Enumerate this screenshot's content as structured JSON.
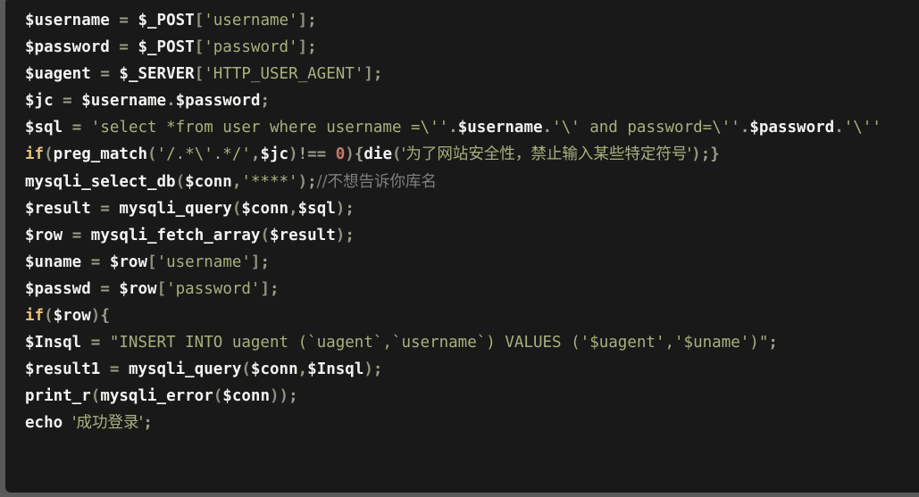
{
  "editor": {
    "language": "php",
    "background_color": "#191919",
    "frame_color": "#5a5a5a",
    "font": "monospace",
    "line_count": 16
  },
  "colors": {
    "variable": "#f2f2f0",
    "string": "#a9b07d",
    "keyword": "#e8c07a",
    "number": "#cc7a6b",
    "comment": "#7e7e7e",
    "operator": "#9aa08a"
  },
  "code": {
    "lines": [
      {
        "n": 1,
        "text": "$username = $_POST['username'];",
        "tokens": [
          {
            "t": "$username",
            "c": "t-var"
          },
          {
            "t": " ",
            "c": "t-plain"
          },
          {
            "t": "=",
            "c": "t-op"
          },
          {
            "t": " ",
            "c": "t-plain"
          },
          {
            "t": "$_POST",
            "c": "t-var"
          },
          {
            "t": "[",
            "c": "t-brk"
          },
          {
            "t": "'username'",
            "c": "t-str"
          },
          {
            "t": "]",
            "c": "t-brk"
          },
          {
            "t": ";",
            "c": "t-punc"
          }
        ]
      },
      {
        "n": 2,
        "text": "$password = $_POST['password'];",
        "tokens": [
          {
            "t": "$password",
            "c": "t-var"
          },
          {
            "t": " ",
            "c": "t-plain"
          },
          {
            "t": "=",
            "c": "t-op"
          },
          {
            "t": " ",
            "c": "t-plain"
          },
          {
            "t": "$_POST",
            "c": "t-var"
          },
          {
            "t": "[",
            "c": "t-brk"
          },
          {
            "t": "'password'",
            "c": "t-str"
          },
          {
            "t": "]",
            "c": "t-brk"
          },
          {
            "t": ";",
            "c": "t-punc"
          }
        ]
      },
      {
        "n": 3,
        "text": "$uagent = $_SERVER['HTTP_USER_AGENT'];",
        "tokens": [
          {
            "t": "$uagent",
            "c": "t-var"
          },
          {
            "t": " ",
            "c": "t-plain"
          },
          {
            "t": "=",
            "c": "t-op"
          },
          {
            "t": " ",
            "c": "t-plain"
          },
          {
            "t": "$_SERVER",
            "c": "t-var"
          },
          {
            "t": "[",
            "c": "t-brk"
          },
          {
            "t": "'HTTP_USER_AGENT'",
            "c": "t-str"
          },
          {
            "t": "]",
            "c": "t-brk"
          },
          {
            "t": ";",
            "c": "t-punc"
          }
        ]
      },
      {
        "n": 4,
        "text": "$jc = $username.$password;",
        "tokens": [
          {
            "t": "$jc",
            "c": "t-var"
          },
          {
            "t": " ",
            "c": "t-plain"
          },
          {
            "t": "=",
            "c": "t-op"
          },
          {
            "t": " ",
            "c": "t-plain"
          },
          {
            "t": "$username",
            "c": "t-var"
          },
          {
            "t": ".",
            "c": "t-punc"
          },
          {
            "t": "$password",
            "c": "t-var"
          },
          {
            "t": ";",
            "c": "t-punc"
          }
        ]
      },
      {
        "n": 5,
        "text": "$sql = 'select *from user where username =\\''.$username.'\\' and password=\\''.$password.'\\''",
        "tokens": [
          {
            "t": "$sql",
            "c": "t-var"
          },
          {
            "t": " ",
            "c": "t-plain"
          },
          {
            "t": "=",
            "c": "t-op"
          },
          {
            "t": " ",
            "c": "t-plain"
          },
          {
            "t": "'select *from user where username =\\''",
            "c": "t-str"
          },
          {
            "t": ".",
            "c": "t-punc"
          },
          {
            "t": "$username",
            "c": "t-var"
          },
          {
            "t": ".",
            "c": "t-punc"
          },
          {
            "t": "'\\' and password=\\''",
            "c": "t-str"
          },
          {
            "t": ".",
            "c": "t-punc"
          },
          {
            "t": "$password",
            "c": "t-var"
          },
          {
            "t": ".",
            "c": "t-punc"
          },
          {
            "t": "'\\''",
            "c": "t-str"
          }
        ]
      },
      {
        "n": 6,
        "text": "if(preg_match('/.*\\'.*/',$jc)!== 0){die('为了网站安全性，禁止输入某些特定符号');}",
        "tokens": [
          {
            "t": "if",
            "c": "t-kw"
          },
          {
            "t": "(",
            "c": "t-brk"
          },
          {
            "t": "preg_match",
            "c": "t-fn"
          },
          {
            "t": "(",
            "c": "t-brk"
          },
          {
            "t": "'/.*\\'.*/'",
            "c": "t-str"
          },
          {
            "t": ",",
            "c": "t-punc"
          },
          {
            "t": "$jc",
            "c": "t-var"
          },
          {
            "t": ")",
            "c": "t-brk"
          },
          {
            "t": "!==",
            "c": "t-op"
          },
          {
            "t": " ",
            "c": "t-plain"
          },
          {
            "t": "0",
            "c": "t-num"
          },
          {
            "t": ")",
            "c": "t-brk"
          },
          {
            "t": "{",
            "c": "t-punc"
          },
          {
            "t": "die",
            "c": "t-fn"
          },
          {
            "t": "(",
            "c": "t-brk"
          },
          {
            "t": "'为了网站安全性，禁止输入某些特定符号'",
            "c": "t-str t-cjk"
          },
          {
            "t": ")",
            "c": "t-brk"
          },
          {
            "t": ";",
            "c": "t-punc"
          },
          {
            "t": "}",
            "c": "t-punc"
          }
        ]
      },
      {
        "n": 7,
        "text": "mysqli_select_db($conn,'****');//不想告诉你库名",
        "tokens": [
          {
            "t": "mysqli_select_db",
            "c": "t-fn"
          },
          {
            "t": "(",
            "c": "t-brk"
          },
          {
            "t": "$conn",
            "c": "t-var"
          },
          {
            "t": ",",
            "c": "t-punc"
          },
          {
            "t": "'****'",
            "c": "t-str"
          },
          {
            "t": ")",
            "c": "t-brk"
          },
          {
            "t": ";",
            "c": "t-punc"
          },
          {
            "t": "//不想告诉你库名",
            "c": "t-com t-cjk"
          }
        ]
      },
      {
        "n": 8,
        "text": "$result = mysqli_query($conn,$sql);",
        "tokens": [
          {
            "t": "$result",
            "c": "t-var"
          },
          {
            "t": " ",
            "c": "t-plain"
          },
          {
            "t": "=",
            "c": "t-op"
          },
          {
            "t": " ",
            "c": "t-plain"
          },
          {
            "t": "mysqli_query",
            "c": "t-fn"
          },
          {
            "t": "(",
            "c": "t-brk"
          },
          {
            "t": "$conn",
            "c": "t-var"
          },
          {
            "t": ",",
            "c": "t-punc"
          },
          {
            "t": "$sql",
            "c": "t-var"
          },
          {
            "t": ")",
            "c": "t-brk"
          },
          {
            "t": ";",
            "c": "t-punc"
          }
        ]
      },
      {
        "n": 9,
        "text": "$row = mysqli_fetch_array($result);",
        "tokens": [
          {
            "t": "$row",
            "c": "t-var"
          },
          {
            "t": " ",
            "c": "t-plain"
          },
          {
            "t": "=",
            "c": "t-op"
          },
          {
            "t": " ",
            "c": "t-plain"
          },
          {
            "t": "mysqli_fetch_array",
            "c": "t-fn"
          },
          {
            "t": "(",
            "c": "t-brk"
          },
          {
            "t": "$result",
            "c": "t-var"
          },
          {
            "t": ")",
            "c": "t-brk"
          },
          {
            "t": ";",
            "c": "t-punc"
          }
        ]
      },
      {
        "n": 10,
        "text": "$uname = $row['username'];",
        "tokens": [
          {
            "t": "$uname",
            "c": "t-var"
          },
          {
            "t": " ",
            "c": "t-plain"
          },
          {
            "t": "=",
            "c": "t-op"
          },
          {
            "t": " ",
            "c": "t-plain"
          },
          {
            "t": "$row",
            "c": "t-var"
          },
          {
            "t": "[",
            "c": "t-brk"
          },
          {
            "t": "'username'",
            "c": "t-str"
          },
          {
            "t": "]",
            "c": "t-brk"
          },
          {
            "t": ";",
            "c": "t-punc"
          }
        ]
      },
      {
        "n": 11,
        "text": "$passwd = $row['password'];",
        "tokens": [
          {
            "t": "$passwd",
            "c": "t-var"
          },
          {
            "t": " ",
            "c": "t-plain"
          },
          {
            "t": "=",
            "c": "t-op"
          },
          {
            "t": " ",
            "c": "t-plain"
          },
          {
            "t": "$row",
            "c": "t-var"
          },
          {
            "t": "[",
            "c": "t-brk"
          },
          {
            "t": "'password'",
            "c": "t-str"
          },
          {
            "t": "]",
            "c": "t-brk"
          },
          {
            "t": ";",
            "c": "t-punc"
          }
        ]
      },
      {
        "n": 12,
        "text": "if($row){",
        "tokens": [
          {
            "t": "if",
            "c": "t-kw"
          },
          {
            "t": "(",
            "c": "t-brk"
          },
          {
            "t": "$row",
            "c": "t-var"
          },
          {
            "t": ")",
            "c": "t-brk"
          },
          {
            "t": "{",
            "c": "t-punc"
          }
        ]
      },
      {
        "n": 13,
        "text": "$Insql = \"INSERT INTO uagent (`uagent`,`username`) VALUES ('$uagent','$uname')\";",
        "tokens": [
          {
            "t": "$Insql",
            "c": "t-var"
          },
          {
            "t": " ",
            "c": "t-plain"
          },
          {
            "t": "=",
            "c": "t-op"
          },
          {
            "t": " ",
            "c": "t-plain"
          },
          {
            "t": "\"INSERT INTO uagent (`uagent`,`username`) VALUES ('$uagent','$uname')\"",
            "c": "t-str"
          },
          {
            "t": ";",
            "c": "t-punc"
          }
        ]
      },
      {
        "n": 14,
        "text": "$result1 = mysqli_query($conn,$Insql);",
        "tokens": [
          {
            "t": "$result1",
            "c": "t-var"
          },
          {
            "t": " ",
            "c": "t-plain"
          },
          {
            "t": "=",
            "c": "t-op"
          },
          {
            "t": " ",
            "c": "t-plain"
          },
          {
            "t": "mysqli_query",
            "c": "t-fn"
          },
          {
            "t": "(",
            "c": "t-brk"
          },
          {
            "t": "$conn",
            "c": "t-var"
          },
          {
            "t": ",",
            "c": "t-punc"
          },
          {
            "t": "$Insql",
            "c": "t-var"
          },
          {
            "t": ")",
            "c": "t-brk"
          },
          {
            "t": ";",
            "c": "t-punc"
          }
        ]
      },
      {
        "n": 15,
        "text": "print_r(mysqli_error($conn));",
        "tokens": [
          {
            "t": "print_r",
            "c": "t-fn"
          },
          {
            "t": "(",
            "c": "t-brk"
          },
          {
            "t": "mysqli_error",
            "c": "t-fn"
          },
          {
            "t": "(",
            "c": "t-brk"
          },
          {
            "t": "$conn",
            "c": "t-var"
          },
          {
            "t": ")",
            "c": "t-brk"
          },
          {
            "t": ")",
            "c": "t-brk"
          },
          {
            "t": ";",
            "c": "t-punc"
          }
        ]
      },
      {
        "n": 16,
        "text": "echo '成功登录';",
        "tokens": [
          {
            "t": "echo",
            "c": "t-echo"
          },
          {
            "t": " ",
            "c": "t-plain"
          },
          {
            "t": "'成功登录'",
            "c": "t-str t-cjk"
          },
          {
            "t": ";",
            "c": "t-punc"
          }
        ]
      }
    ]
  }
}
